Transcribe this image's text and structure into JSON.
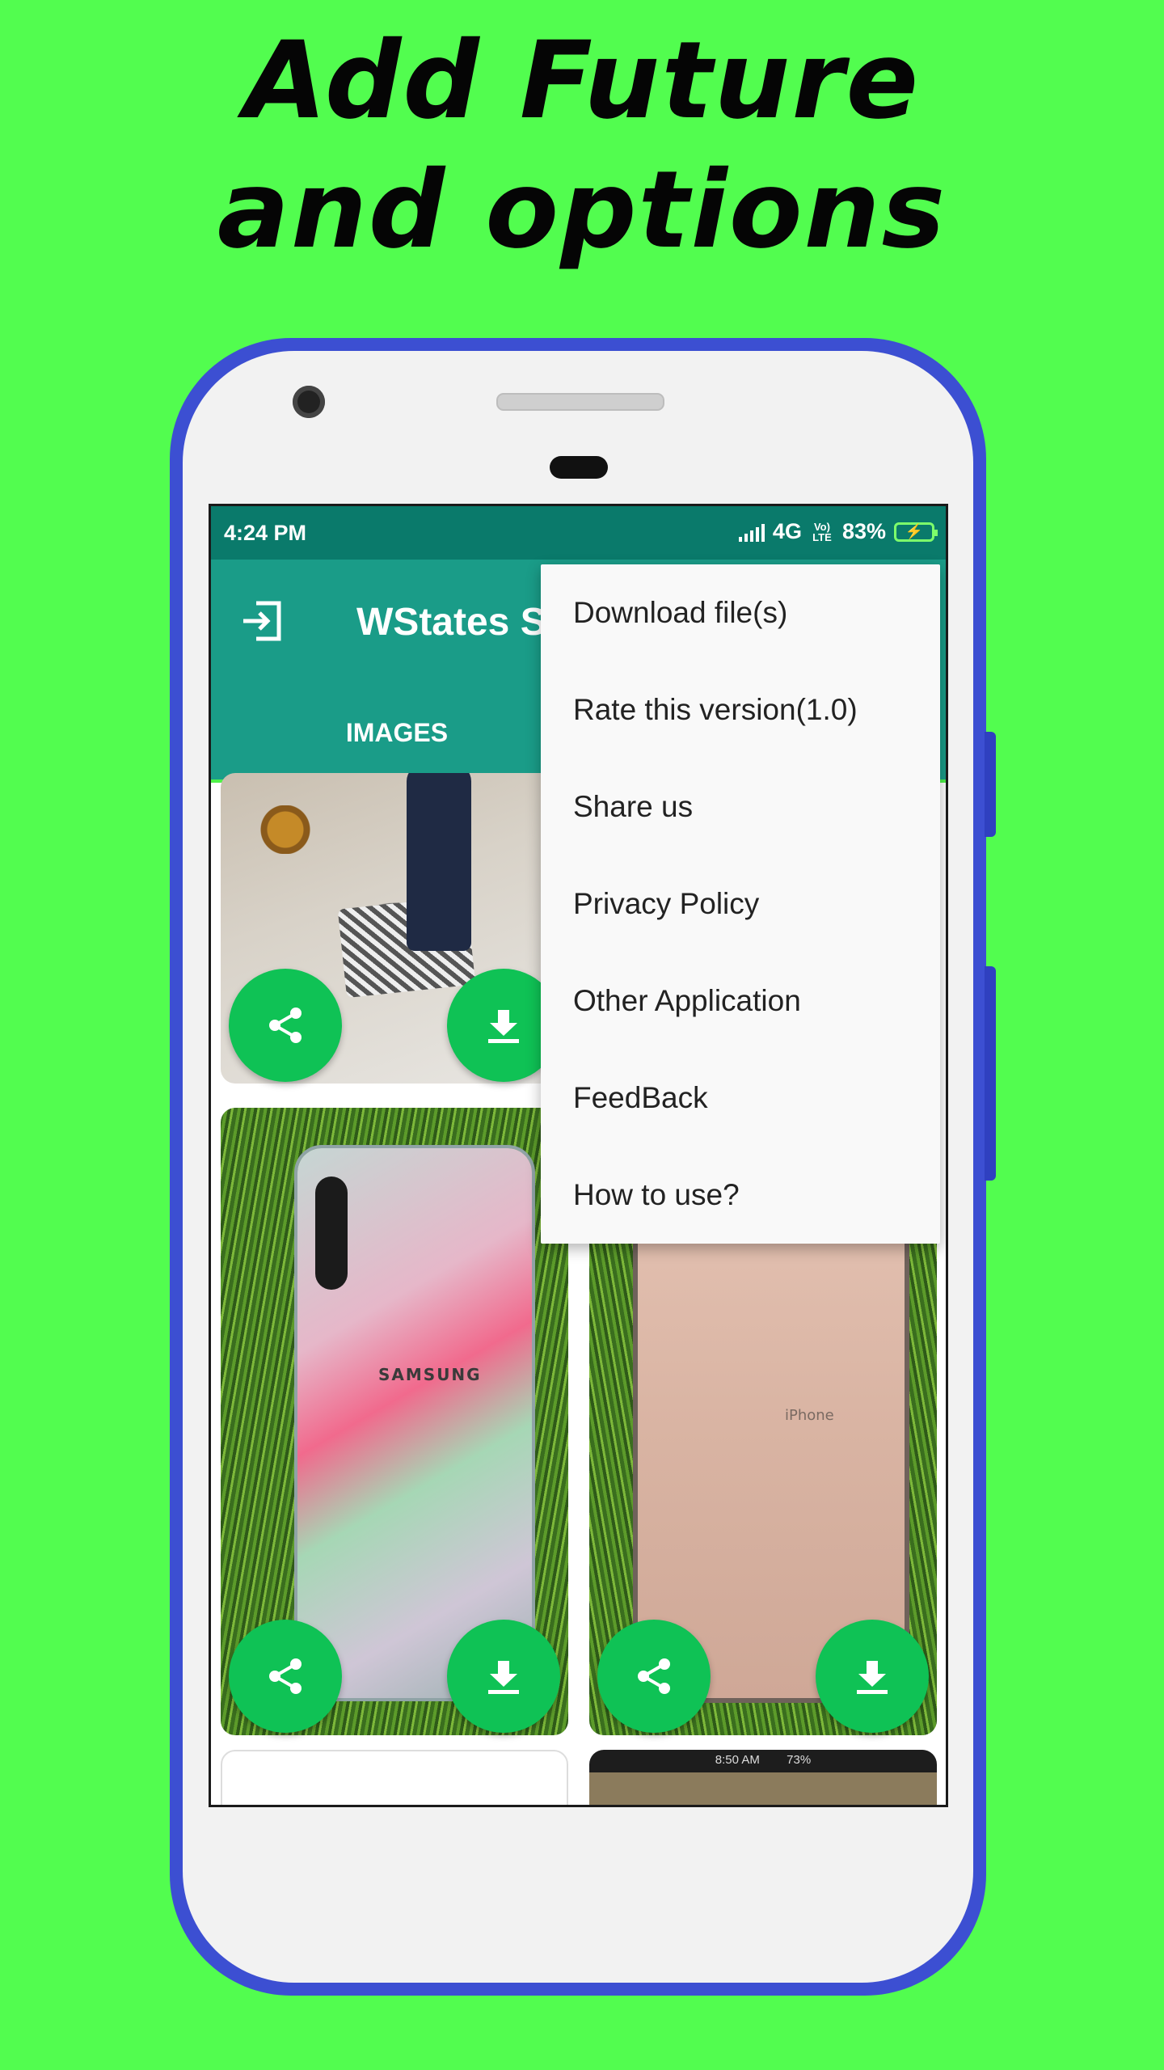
{
  "promo": {
    "line1": "Add Future",
    "line2": "and options"
  },
  "colors": {
    "background": "#52fd4f",
    "status_bar": "#0a7a6b",
    "app_bar": "#1a9c88",
    "fab": "#0fc255",
    "phone_frame": "#3c4fd2"
  },
  "status_bar": {
    "time": "4:24 PM",
    "network": "4G",
    "volte": "Vo) LTE",
    "battery": "83%"
  },
  "app_bar": {
    "title": "WStates S",
    "tab_images": "IMAGES"
  },
  "menu": {
    "items": [
      {
        "label": "Download file(s)"
      },
      {
        "label": "Rate this version(1.0)"
      },
      {
        "label": "Share us"
      },
      {
        "label": "Privacy Policy"
      },
      {
        "label": "Other Application"
      },
      {
        "label": "FeedBack"
      },
      {
        "label": "How to use?"
      }
    ]
  },
  "thumbnails": {
    "samsung_text": "SAMSUNG",
    "iphone_text": "iPhone",
    "mini_status_time": "8:50 AM",
    "mini_status_battery": "73%"
  }
}
